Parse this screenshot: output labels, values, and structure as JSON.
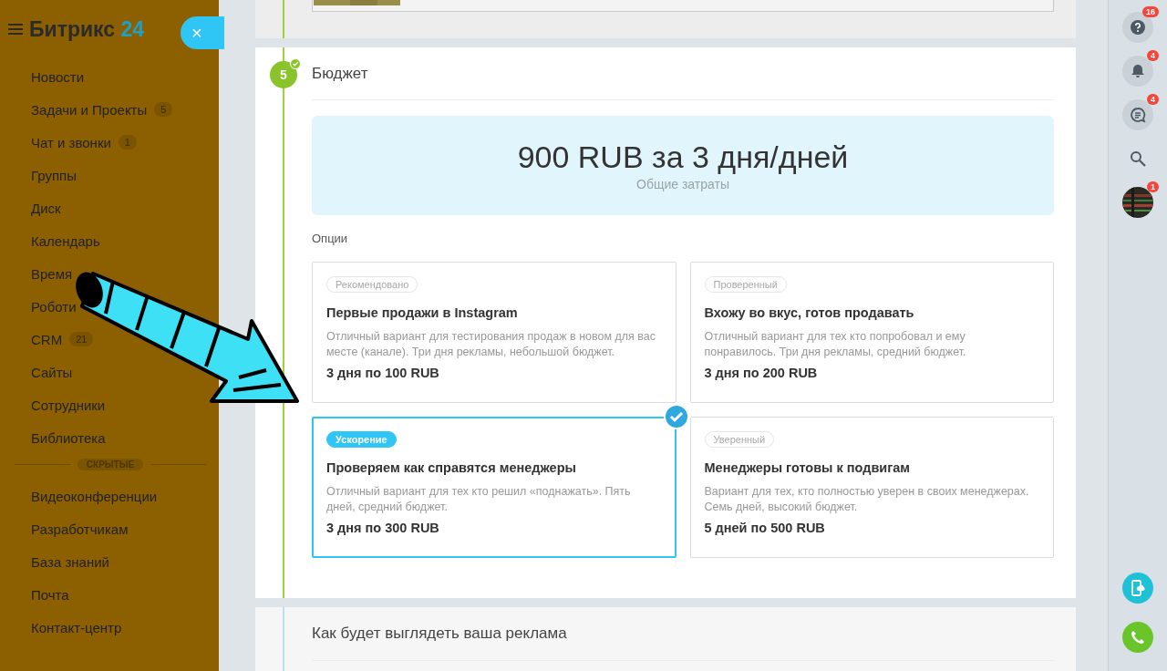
{
  "sidebar": {
    "logo": {
      "name": "Битрикс",
      "number": "24"
    },
    "close": "×",
    "items": [
      {
        "label": "Новости"
      },
      {
        "label": "Задачи и Проекты",
        "counter": "5"
      },
      {
        "label": "Чат и звонки",
        "counter": "1"
      },
      {
        "label": "Группы"
      },
      {
        "label": "Диск"
      },
      {
        "label": "Календарь"
      },
      {
        "label": "Время"
      },
      {
        "label": "Роботи"
      },
      {
        "label": "CRM",
        "counter": "21"
      },
      {
        "label": "Сайты"
      },
      {
        "label": "Сотрудники"
      },
      {
        "label": "Библиотека"
      }
    ],
    "hidden_divider": "СКРЫТЫЕ",
    "hidden_items": [
      {
        "label": "Видеоконференции"
      },
      {
        "label": "Разработчикам"
      },
      {
        "label": "База знаний"
      },
      {
        "label": "Почта"
      },
      {
        "label": "Контакт-центр"
      }
    ]
  },
  "budget_step": {
    "number": "5",
    "done": true,
    "title": "Бюджет",
    "total": {
      "amount": "900 RUB за 3 дня/дней",
      "caption": "Общие затраты"
    },
    "options_label": "Опции",
    "options": [
      {
        "tag": "Рекомендовано",
        "title": "Первые продажи в Instagram",
        "description": "Отличный вариант для тестирования продаж в новом для вас месте (канале). Три дня рекламы, небольшой бюджет.",
        "price": "3 дня по 100 RUB",
        "selected": false
      },
      {
        "tag": "Проверенный",
        "title": "Вхожу во вкус, готов продавать",
        "description": "Отличный вариант для тех кто попробовал и ему понравилось. Три дня рекламы, средний бюджет.",
        "price": "3 дня по 200 RUB",
        "selected": false
      },
      {
        "tag": "Ускорение",
        "title": "Проверяем как справятся менеджеры",
        "description": "Отличный вариант для тех кто решил «поднажать». Пять дней, средний бюджет.",
        "price": "3 дня по 300 RUB",
        "selected": true
      },
      {
        "tag": "Уверенный",
        "title": "Менеджеры готовы к подвигам",
        "description": "Вариант для тех, кто полностью уверен в своих менеджерах. Семь дней, высокий бюджет.",
        "price": "5 дней по 500 RUB",
        "selected": false
      }
    ]
  },
  "next_step": {
    "title": "Как будет выглядеть ваша реклама"
  },
  "right_panel": {
    "items": [
      {
        "kind": "help",
        "badge": "16"
      },
      {
        "kind": "bell",
        "badge": "4"
      },
      {
        "kind": "chat",
        "badge": "4"
      },
      {
        "kind": "search"
      },
      {
        "kind": "avatar",
        "badge": "1"
      }
    ],
    "bottom": [
      {
        "kind": "mobile"
      },
      {
        "kind": "phone"
      }
    ]
  }
}
